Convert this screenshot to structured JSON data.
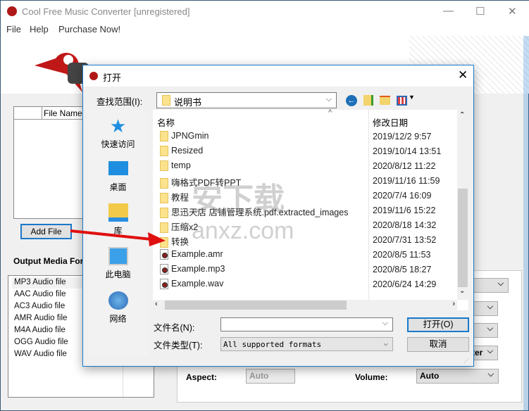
{
  "app": {
    "title": "Cool Free Music Converter  [unregistered]",
    "menu": [
      "File",
      "Help",
      "Purchase Now!"
    ]
  },
  "main": {
    "file_list": {
      "columns": [
        "",
        "File Name"
      ]
    },
    "add_file_label": "Add File",
    "output_format_label": "Output Media Format",
    "formats": [
      "MP3 Audio file",
      "AAC Audio file",
      "AC3 Audio file",
      "AMR Audio file",
      "M4A Audio file",
      "OGG Audio file",
      "WAV Audio file"
    ],
    "settings": {
      "partial_label": "ter",
      "aspect_label": "Aspect:",
      "aspect_value": "Auto",
      "volume_label": "Volume:",
      "volume_value": "Auto"
    }
  },
  "dialog": {
    "title": "打开",
    "look_in_label": "查找范围(I):",
    "look_in_value": "说明书",
    "places": [
      "快速访问",
      "桌面",
      "库",
      "此电脑",
      "网络"
    ],
    "columns": {
      "name": "名称",
      "date": "修改日期"
    },
    "files": [
      {
        "name": "JPNGmin",
        "date": "2019/12/2 9:57",
        "type": "folder"
      },
      {
        "name": "Resized",
        "date": "2019/10/14 13:51",
        "type": "folder"
      },
      {
        "name": "temp",
        "date": "2020/8/12 11:22",
        "type": "folder"
      },
      {
        "name": "嗨格式PDF转PPT",
        "date": "2019/11/16 11:59",
        "type": "folder"
      },
      {
        "name": "教程",
        "date": "2020/7/4 16:09",
        "type": "folder"
      },
      {
        "name": "思迅天店 店铺管理系统.pdf.extracted_images",
        "date": "2019/11/6 15:22",
        "type": "folder"
      },
      {
        "name": "压缩x2",
        "date": "2020/8/18 14:32",
        "type": "folder"
      },
      {
        "name": "转换",
        "date": "2020/7/31 13:52",
        "type": "folder"
      },
      {
        "name": "Example.amr",
        "date": "2020/8/5 11:53",
        "type": "audio"
      },
      {
        "name": "Example.mp3",
        "date": "2020/8/5 18:27",
        "type": "audio"
      },
      {
        "name": "Example.wav",
        "date": "2020/6/24 14:29",
        "type": "audio"
      }
    ],
    "filename_label": "文件名(N):",
    "filename_value": "",
    "filetype_label": "文件类型(T):",
    "filetype_value": "All supported formats",
    "open_label": "打开(O)",
    "cancel_label": "取消"
  },
  "watermark": {
    "text": "安下载",
    "sub": "anxz.com"
  },
  "colors": {
    "accent": "#1979ca",
    "arrow": "#e01010",
    "folder": "#fbe28c"
  }
}
